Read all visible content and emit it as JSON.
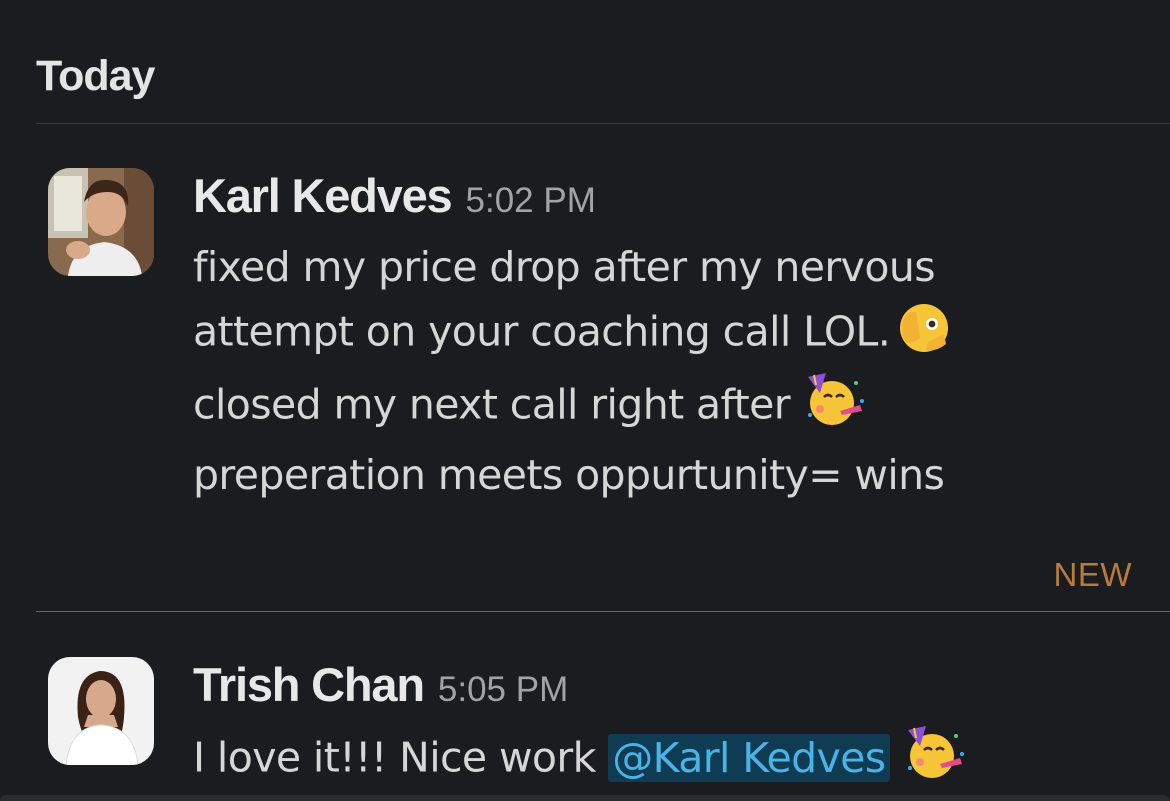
{
  "day_header": "Today",
  "new_marker": "NEW",
  "messages": [
    {
      "author": "Karl Kedves",
      "time": "5:02 PM",
      "lines": [
        "fixed my price drop after my nervous",
        "attempt on your coaching call LOL.",
        "closed my next call right after",
        "preperation meets oppurtunity= wins"
      ],
      "emojis": [
        "face-with-open-eyes-and-hand-over-mouth-emoji",
        "partying-face-emoji"
      ]
    },
    {
      "author": "Trish Chan",
      "time": "5:05 PM",
      "text": "I love it!!! Nice work",
      "mention": "@Karl Kedves",
      "emojis": [
        "partying-face-emoji"
      ]
    }
  ],
  "colors": {
    "background": "#1b1c1f",
    "new_marker": "#b87b3c",
    "mention_bg": "#0f3c52",
    "mention_text": "#49b3e8"
  }
}
